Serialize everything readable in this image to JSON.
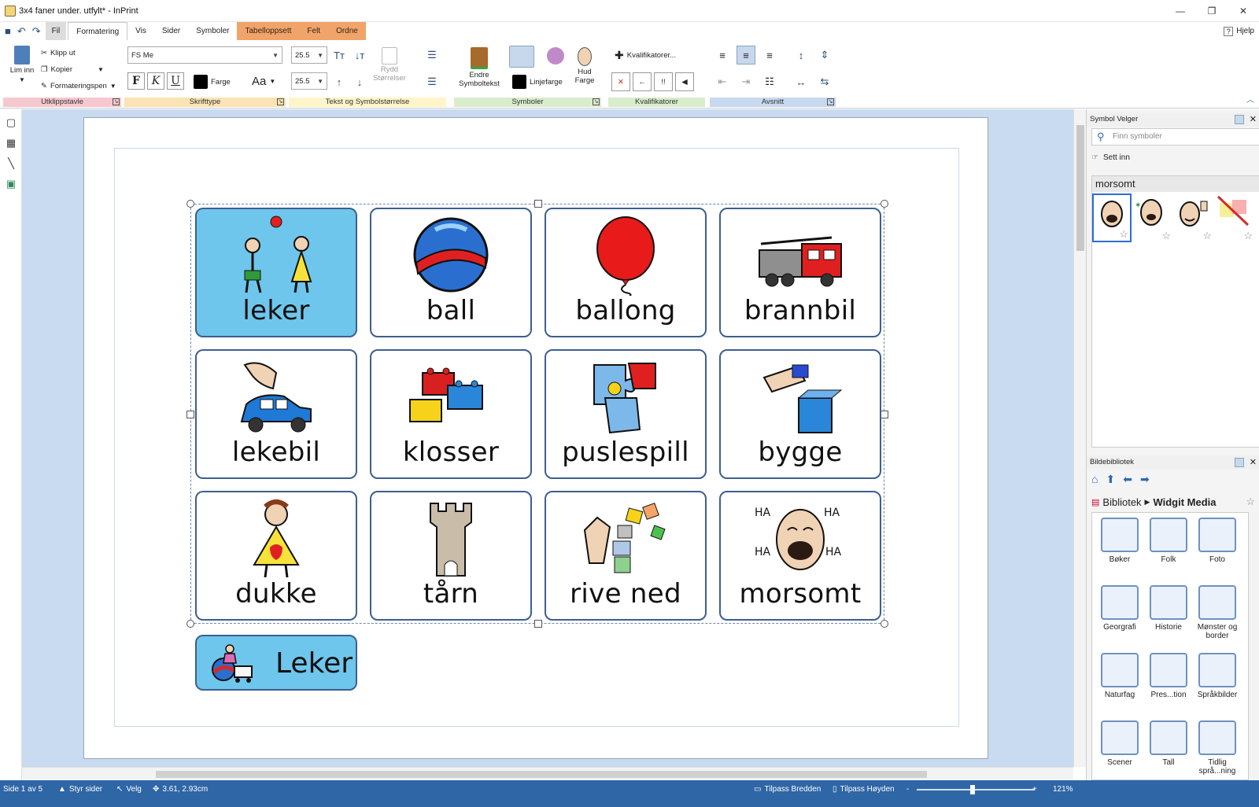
{
  "window": {
    "title": "3x4 faner under. utfylt* - InPrint"
  },
  "menu": {
    "fil": "Fil",
    "tabs": [
      "Formatering",
      "Vis",
      "Sider",
      "Symboler"
    ],
    "context_tabs": [
      "Tabelloppsett",
      "Felt",
      "Ordne"
    ],
    "help": "Hjelp"
  },
  "ribbon": {
    "clipboard": {
      "paste": "Lim inn",
      "cut": "Klipp ut",
      "copy": "Kopier",
      "format_painter": "Formateringspen",
      "label": "Utklippstavle"
    },
    "font": {
      "family": "FS Me",
      "bold": "F",
      "italic": "K",
      "underline": "U",
      "color_label": "Farge",
      "case": "Aa",
      "label": "Skrifttype"
    },
    "sizes": {
      "text_size": "25.5",
      "symbol_size": "25.5",
      "tidy": "Rydd Størrelser",
      "label": "Tekst og Symbolstørrelse"
    },
    "symbols": {
      "change_text": "Endre Symboltekst",
      "line_color": "Linjefarge",
      "skin": "Hud Farge",
      "label": "Symboler"
    },
    "qualifiers": {
      "button": "Kvalifikatorer...",
      "label": "Kvalifikatorer"
    },
    "paragraph": {
      "label": "Avsnitt"
    }
  },
  "colors": {
    "cell_active": "#6ec6ec",
    "cell_border": "#3d5f8e",
    "context_tab": "#f0a46a",
    "statusbar": "#2f66a6",
    "workspace": "#c9dbf0"
  },
  "grid": {
    "cells": [
      {
        "word": "leker",
        "icon": "children-playing-icon",
        "active": true
      },
      {
        "word": "ball",
        "icon": "ball-icon"
      },
      {
        "word": "ballong",
        "icon": "balloon-icon"
      },
      {
        "word": "brannbil",
        "icon": "fire-engine-icon"
      },
      {
        "word": "lekebil",
        "icon": "toy-car-icon"
      },
      {
        "word": "klosser",
        "icon": "building-blocks-icon"
      },
      {
        "word": "puslespill",
        "icon": "puzzle-icon"
      },
      {
        "word": "bygge",
        "icon": "build-icon"
      },
      {
        "word": "dukke",
        "icon": "doll-icon"
      },
      {
        "word": "tårn",
        "icon": "tower-icon"
      },
      {
        "word": "rive ned",
        "icon": "knock-down-icon"
      },
      {
        "word": "morsomt",
        "icon": "laughing-face-icon"
      }
    ]
  },
  "legend": {
    "word": "Leker",
    "icon": "toys-icon"
  },
  "symbol_picker": {
    "title": "Symbol Velger",
    "search_placeholder": "Finn symboler",
    "insert": "Sett inn",
    "word": "morsomt"
  },
  "library": {
    "title": "Bildebibliotek",
    "path_root": "Bibliotek",
    "path_current": "Widgit Media",
    "folders": [
      "Bøker",
      "Folk",
      "Foto",
      "Georgrafi",
      "Historie",
      "Mønster og border",
      "Naturfag",
      "Pres...tion",
      "Språkbilder",
      "Scener",
      "Tall",
      "Tidlig språ...ning"
    ]
  },
  "status": {
    "page": "Side 1 av 5",
    "manage_pages": "Styr sider",
    "select": "Velg",
    "coords": "3.61, 2.93cm",
    "fit_width": "Tilpass Bredden",
    "fit_height": "Tilpass Høyden",
    "zoom": "121%",
    "zoom_minus": "-",
    "zoom_plus": "+"
  }
}
